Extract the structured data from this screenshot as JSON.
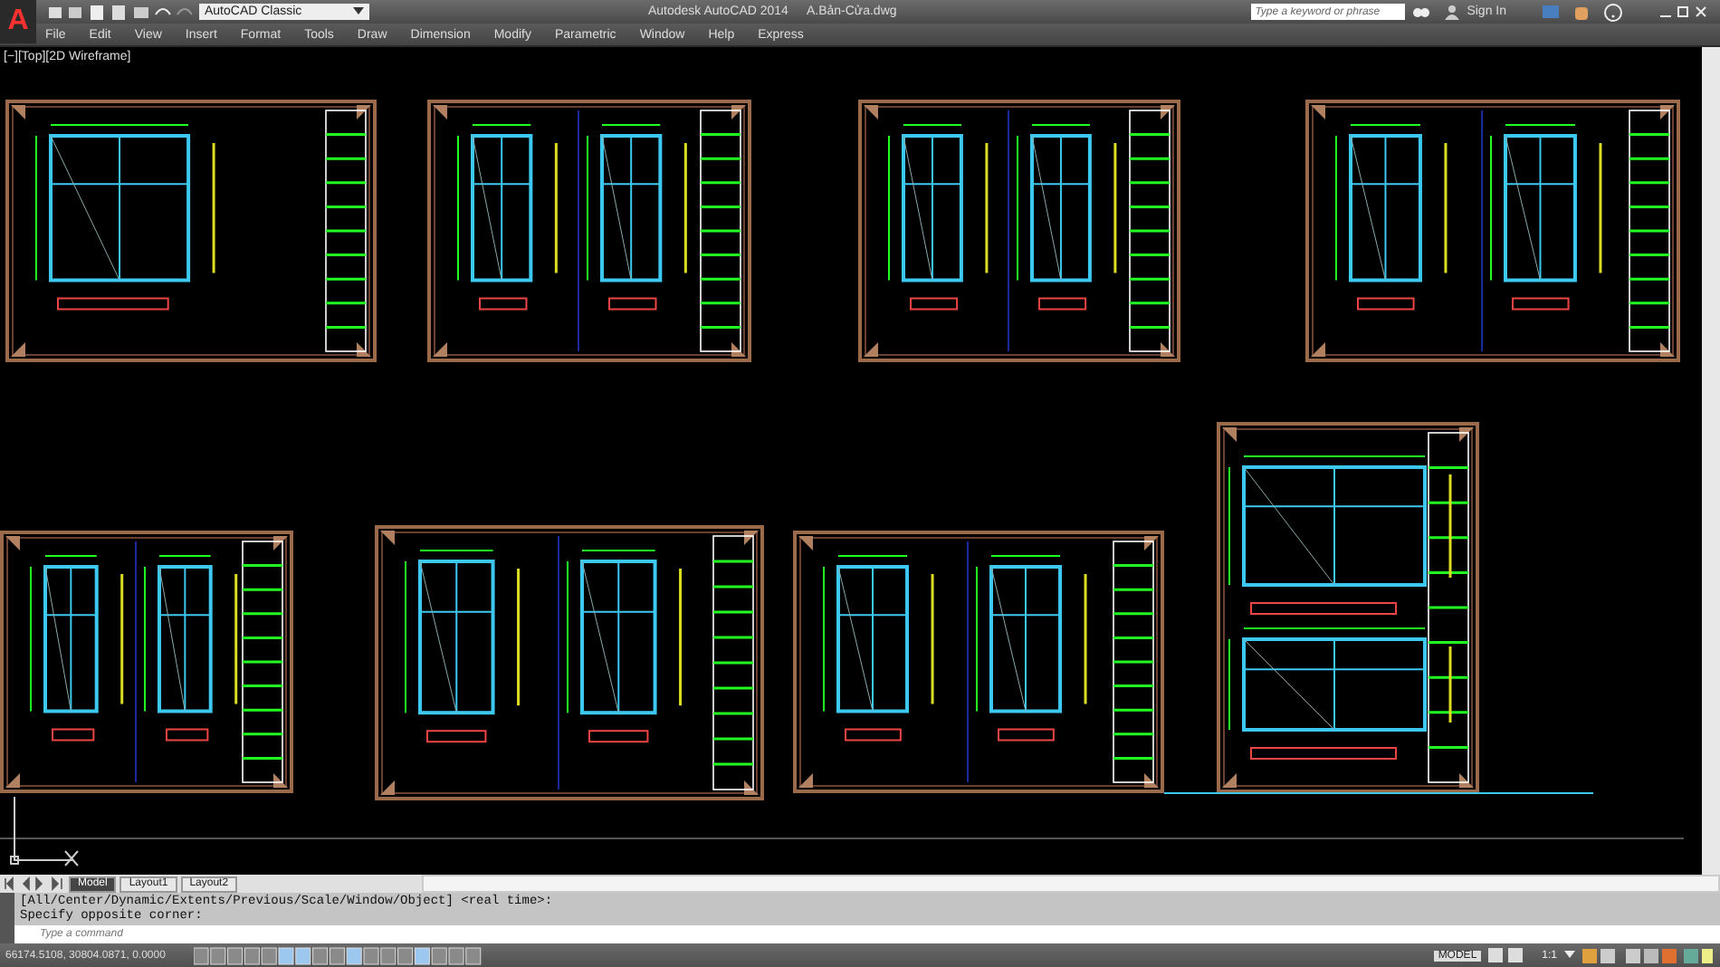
{
  "title_bar": {
    "app_button": "A",
    "workspace": "AutoCAD Classic",
    "app_title": "Autodesk AutoCAD 2014",
    "file_name": "A.Bản-Cửa.dwg",
    "search": {
      "placeholder": "Type a keyword or phrase"
    },
    "sign_in": "Sign In"
  },
  "menu_bar": [
    "File",
    "Edit",
    "View",
    "Insert",
    "Format",
    "Tools",
    "Draw",
    "Dimension",
    "Modify",
    "Parametric",
    "Window",
    "Help",
    "Express"
  ],
  "viewport": {
    "label": "[−][Top][2D Wireframe]"
  },
  "layout_tabs": [
    {
      "label": "Model",
      "selected": true
    },
    {
      "label": "Layout1",
      "selected": false
    },
    {
      "label": "Layout2",
      "selected": false
    }
  ],
  "command_history": [
    "[All/Center/Dynamic/Extents/Previous/Scale/Window/Object] <real time>:",
    "Specify opposite corner:"
  ],
  "command_line": {
    "placeholder": "Type a command"
  },
  "status_bar": {
    "coordinates": "66174.5108, 30804.0871, 0.0000",
    "space": "MODEL",
    "scale": "1:1"
  }
}
